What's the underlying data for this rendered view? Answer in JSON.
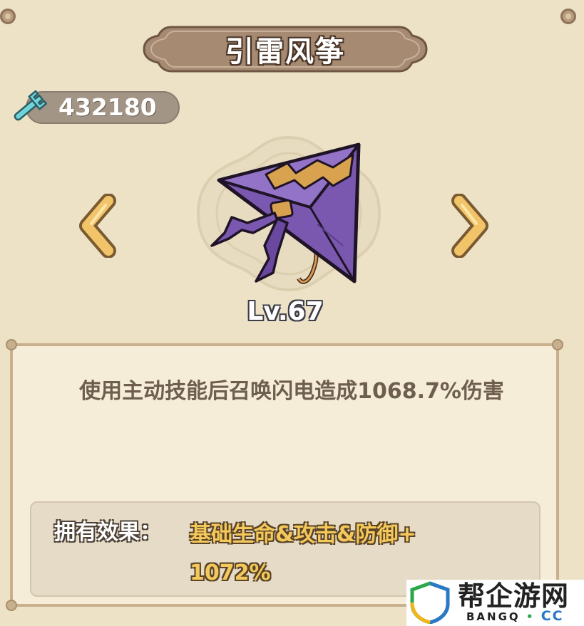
{
  "title": "引雷风筝",
  "currency": {
    "icon": "wrench-icon",
    "value": "432180"
  },
  "item": {
    "name": "引雷风筝",
    "level": "Lv.67",
    "icon": "purple-kite-icon"
  },
  "navigation": {
    "prev_icon": "chevron-left-icon",
    "next_icon": "chevron-right-icon"
  },
  "description": "使用主动技能后召唤闪电造成1068.7%伤害",
  "effect": {
    "label": "拥有效果：",
    "value_line1": "基础生命&攻击&防御+",
    "value_line2": "1072%"
  },
  "watermark": {
    "title": "帮企游网",
    "sub": "BANGQ",
    "dot": "•",
    "cc": "CC"
  },
  "colors": {
    "background": "#ede2c6",
    "banner": "#a68a72",
    "effect_value": "#f4c85a",
    "arrow": "#f2c46a",
    "kite": "#7b58b0"
  }
}
